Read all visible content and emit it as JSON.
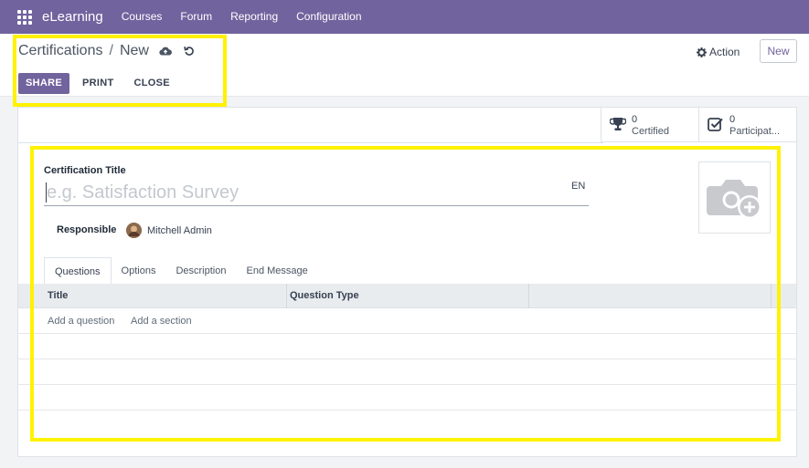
{
  "navbar": {
    "brand": "eLearning",
    "menu": [
      "Courses",
      "Forum",
      "Reporting",
      "Configuration"
    ]
  },
  "control": {
    "breadcrumb": {
      "parent": "Certifications",
      "separator": "/",
      "current": "New"
    },
    "action_label": "Action",
    "new_label": "New",
    "toolbar": {
      "share": "SHARE",
      "print": "PRINT",
      "close": "CLOSE"
    }
  },
  "stats": [
    {
      "count": "0",
      "label": "Certified",
      "icon": "trophy-icon"
    },
    {
      "count": "0",
      "label": "Participat...",
      "icon": "check-square-icon"
    }
  ],
  "form": {
    "title_label": "Certification Title",
    "title_placeholder": "e.g. Satisfaction Survey",
    "title_value": "",
    "lang": "EN",
    "responsible_label": "Responsible",
    "responsible_value": "Mitchell Admin"
  },
  "tabs": [
    "Questions",
    "Options",
    "Description",
    "End Message"
  ],
  "active_tab": "Questions",
  "grid": {
    "columns": [
      "Title",
      "Question Type"
    ],
    "add_question": "Add a question",
    "add_section": "Add a section"
  },
  "colors": {
    "brand": "#71639e",
    "highlight": "#fff200"
  }
}
